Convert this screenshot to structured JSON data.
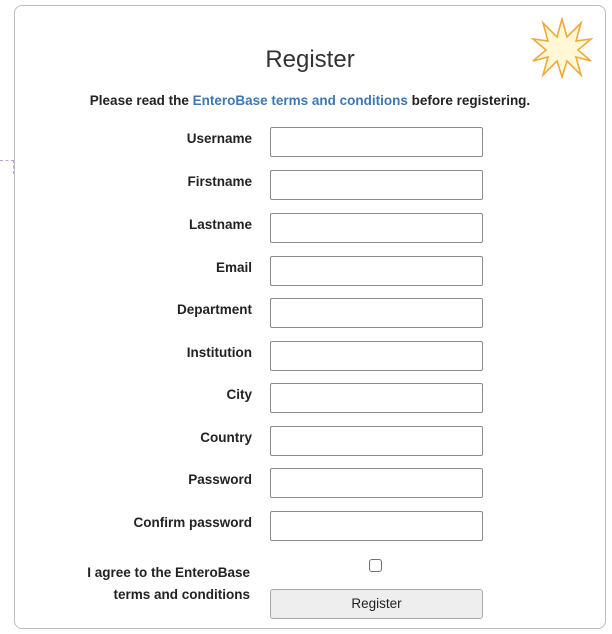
{
  "dialog": {
    "title": "Register",
    "notice_prefix": "Please read the ",
    "notice_link": "EnteroBase terms and conditions",
    "notice_suffix": " before registering."
  },
  "fields": [
    {
      "label": "Username",
      "value": ""
    },
    {
      "label": "Firstname",
      "value": ""
    },
    {
      "label": "Lastname",
      "value": ""
    },
    {
      "label": "Email",
      "value": ""
    },
    {
      "label": "Department",
      "value": ""
    },
    {
      "label": "Institution",
      "value": ""
    },
    {
      "label": "City",
      "value": ""
    },
    {
      "label": "Country",
      "value": ""
    },
    {
      "label": "Password",
      "value": ""
    },
    {
      "label": "Confirm password",
      "value": ""
    }
  ],
  "agree": {
    "line1": "I agree to the EnteroBase",
    "line2": "terms and conditions",
    "checked": false
  },
  "register_button": "Register",
  "colors": {
    "link": "#3b78b5",
    "star_fill": "#fff7d6",
    "star_stroke": "#f0a93b"
  },
  "icons": {
    "decoration": "starburst-icon"
  }
}
